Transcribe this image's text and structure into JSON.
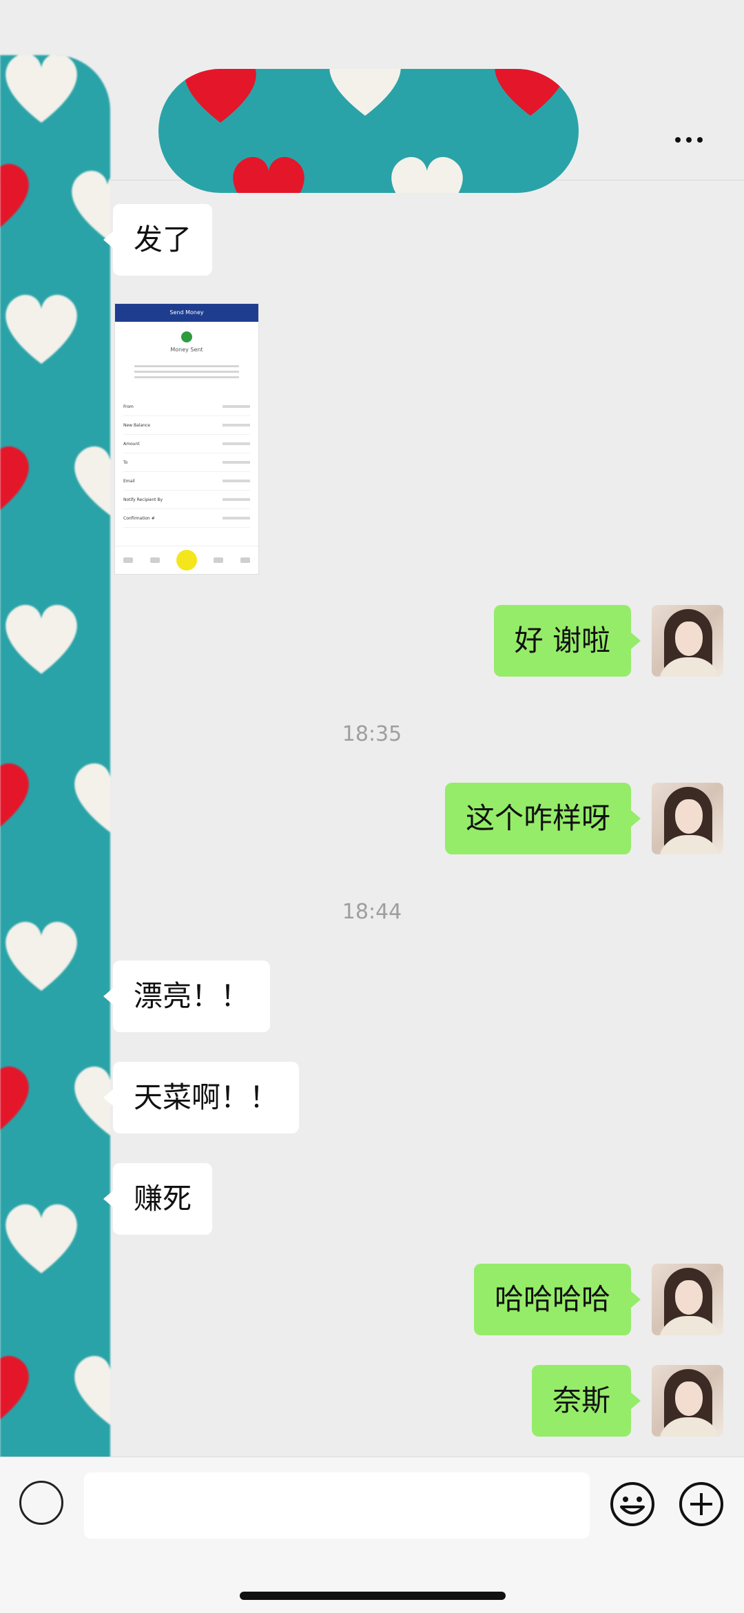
{
  "header": {
    "contact_name": "",
    "more_label": "More"
  },
  "messages": [
    {
      "type": "text",
      "side": "in",
      "text": "发了"
    },
    {
      "type": "image",
      "side": "in",
      "title": "Send Money",
      "subtitle": "Money Sent",
      "rows": [
        "From",
        "New Balance",
        "Amount",
        "To",
        "Email",
        "Notify Recipient By",
        "Confirmation #"
      ]
    },
    {
      "type": "text",
      "side": "out",
      "text": "好 谢啦"
    },
    {
      "type": "time",
      "text": "18:35"
    },
    {
      "type": "text",
      "side": "out",
      "text": "这个咋样呀"
    },
    {
      "type": "time",
      "text": "18:44"
    },
    {
      "type": "text",
      "side": "in",
      "text": "漂亮！！"
    },
    {
      "type": "text",
      "side": "in",
      "text": "天菜啊！！"
    },
    {
      "type": "text",
      "side": "in",
      "text": "赚死"
    },
    {
      "type": "text",
      "side": "out",
      "text": "哈哈哈哈"
    },
    {
      "type": "text",
      "side": "out",
      "text": "奈斯"
    }
  ],
  "input": {
    "value": "",
    "placeholder": ""
  },
  "icons": {
    "voice": "voice-icon",
    "emoji": "emoji-icon",
    "plus": "plus-icon",
    "more": "more-icon"
  },
  "colors": {
    "background": "#ededed",
    "incoming_bubble": "#ffffff",
    "outgoing_bubble": "#95ec69",
    "time_text": "#9e9e9e"
  }
}
